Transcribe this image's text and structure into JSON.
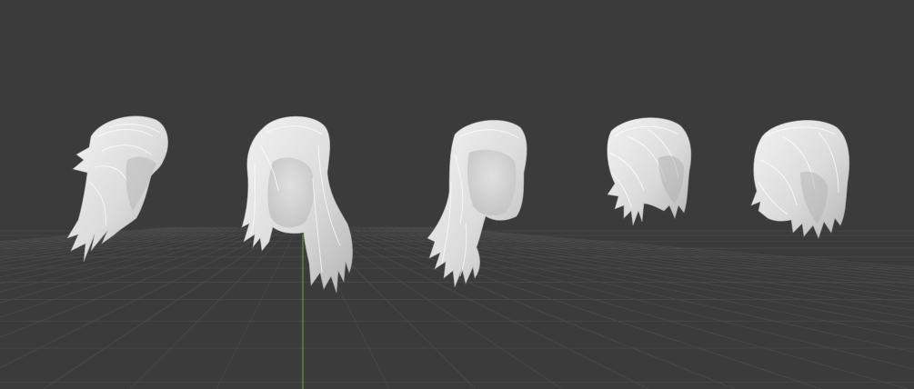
{
  "viewport": {
    "background_color": "#3b3b3b",
    "grid_color": "#4a4a4a",
    "z_axis_color": "#6f8f3a",
    "hair_color": "#e6e6e6",
    "hair_shadow_color": "#a9a9a9"
  },
  "objects": [
    {
      "icon": "hair-mesh-icon",
      "style": "side-swept short with long ends"
    },
    {
      "icon": "hair-mesh-icon",
      "style": "long layered with bangs"
    },
    {
      "icon": "hair-mesh-icon",
      "style": "long side part"
    },
    {
      "icon": "hair-mesh-icon",
      "style": "short swept bob"
    },
    {
      "icon": "hair-mesh-icon",
      "style": "layered bob"
    }
  ]
}
